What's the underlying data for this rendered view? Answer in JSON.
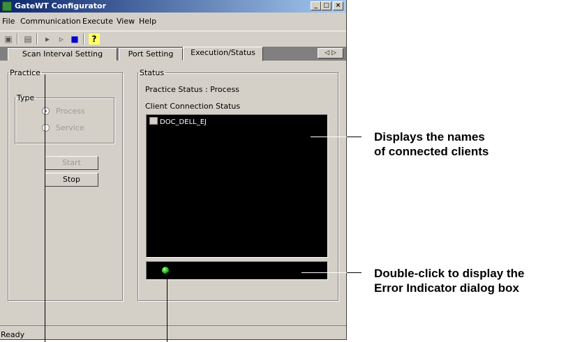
{
  "window": {
    "title": "GateWT Configurator",
    "icon": "app-icon",
    "controls": [
      "minimize-icon",
      "maximize-icon",
      "close-icon"
    ]
  },
  "menu": [
    "File",
    "Communication",
    "Execute",
    "View",
    "Help"
  ],
  "toolbar": {
    "buttons": [
      "save-icon",
      "connect-icon",
      "run-icon",
      "step-icon",
      "stop-icon",
      "help-icon"
    ],
    "help_glyph": "?"
  },
  "tabs": [
    {
      "label": "Scan Interval Setting",
      "active": false
    },
    {
      "label": "Port Setting",
      "active": false
    },
    {
      "label": "Execution/Status",
      "active": true
    }
  ],
  "tab_scroll": {
    "left": "◁",
    "right": "▷"
  },
  "practice": {
    "legend": "Practice",
    "type_legend": "Type",
    "options": [
      {
        "label": "Process",
        "checked": true,
        "enabled": false
      },
      {
        "label": "Service",
        "checked": false,
        "enabled": false
      }
    ],
    "start_label": "Start",
    "stop_label": "Stop"
  },
  "status": {
    "legend": "Status",
    "practice_status": "Practice Status : Process",
    "client_connection_label": "Client Connection Status",
    "clients": [
      "DOC_DELL_EJ"
    ],
    "error_indicator_color": "#10b010"
  },
  "statusbar": {
    "text": "Ready"
  },
  "callouts": {
    "clients": [
      "Displays the names",
      "of connected clients"
    ],
    "error": [
      "Double-click to display the",
      "Error Indicator dialog box"
    ]
  },
  "colors": {
    "title_start": "#0a246a",
    "title_end": "#a6caf0",
    "face": "#d4d0c8",
    "list_bg": "#000000"
  }
}
